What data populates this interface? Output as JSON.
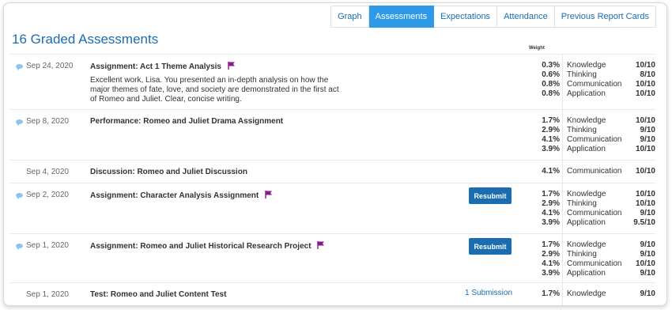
{
  "tabs": [
    {
      "label": "Graph",
      "active": false
    },
    {
      "label": "Assessments",
      "active": true
    },
    {
      "label": "Expectations",
      "active": false
    },
    {
      "label": "Attendance",
      "active": false
    },
    {
      "label": "Previous Report Cards",
      "active": false
    }
  ],
  "title": "16 Graded Assessments",
  "weight_header": "Weight",
  "assessments": [
    {
      "date": "Sep 24, 2020",
      "title": "Assignment: Act 1 Theme Analysis",
      "flagged": true,
      "has_comment": true,
      "comment": "Excellent work, Lisa. You presented an in-depth analysis on how the major themes of fate, love, and society are demonstrated in the first act of Romeo and Juliet. Clear, concise writing.",
      "weights": [
        "0.3%",
        "0.6%",
        "0.8%",
        "0.8%"
      ],
      "categories": [
        {
          "name": "Knowledge",
          "score": "10/10"
        },
        {
          "name": "Thinking",
          "score": "8/10"
        },
        {
          "name": "Communication",
          "score": "10/10"
        },
        {
          "name": "Application",
          "score": "10/10"
        }
      ]
    },
    {
      "date": "Sep 8, 2020",
      "title": "Performance: Romeo and Juliet Drama Assignment",
      "flagged": false,
      "has_comment": true,
      "weights": [
        "1.7%",
        "2.9%",
        "4.1%",
        "3.9%"
      ],
      "categories": [
        {
          "name": "Knowledge",
          "score": "10/10"
        },
        {
          "name": "Thinking",
          "score": "9/10"
        },
        {
          "name": "Communication",
          "score": "9/10"
        },
        {
          "name": "Application",
          "score": "10/10"
        }
      ]
    },
    {
      "date": "Sep 4, 2020",
      "title": "Discussion: Romeo and Juliet Discussion",
      "flagged": false,
      "has_comment": false,
      "weights": [
        "4.1%"
      ],
      "categories": [
        {
          "name": "Communication",
          "score": "10/10"
        }
      ]
    },
    {
      "date": "Sep 2, 2020",
      "title": "Assignment: Character Analysis Assignment",
      "flagged": true,
      "has_comment": true,
      "action": "Resubmit",
      "weights": [
        "1.7%",
        "2.9%",
        "4.1%",
        "3.9%"
      ],
      "categories": [
        {
          "name": "Knowledge",
          "score": "10/10"
        },
        {
          "name": "Thinking",
          "score": "10/10"
        },
        {
          "name": "Communication",
          "score": "9/10"
        },
        {
          "name": "Application",
          "score": "9.5/10"
        }
      ]
    },
    {
      "date": "Sep 1, 2020",
      "title": "Assignment: Romeo and Juliet Historical Research Project",
      "flagged": true,
      "has_comment": true,
      "action": "Resubmit",
      "weights": [
        "1.7%",
        "2.9%",
        "4.1%",
        "3.9%"
      ],
      "categories": [
        {
          "name": "Knowledge",
          "score": "9/10"
        },
        {
          "name": "Thinking",
          "score": "9/10"
        },
        {
          "name": "Communication",
          "score": "10/10"
        },
        {
          "name": "Application",
          "score": "9/10"
        }
      ]
    },
    {
      "date": "Sep 1, 2020",
      "title": "Test: Romeo and Juliet Content Test",
      "flagged": false,
      "has_comment": false,
      "link": "1 Submission",
      "weights": [
        "1.7%"
      ],
      "categories": [
        {
          "name": "Knowledge",
          "score": "9/10"
        }
      ]
    }
  ],
  "colors": {
    "accent": "#1a6db0",
    "active_tab": "#2d9ae8",
    "flag": "#8a1a8c",
    "comment_icon": "#8fc4ec"
  }
}
